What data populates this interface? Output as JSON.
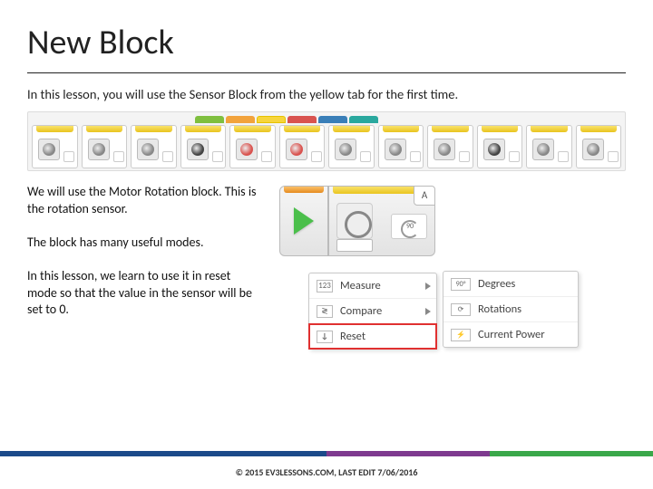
{
  "title": "New Block",
  "intro": "In this lesson, you will use the Sensor Block from the yellow tab for the first time.",
  "para1": "We will use the Motor Rotation block.  This is the rotation sensor.",
  "para2": "The block has many useful modes.",
  "para3": "In this lesson, we learn to use it in reset mode so that the value in the sensor will be set to 0.",
  "port_label": "A",
  "menu": {
    "measure": "Measure",
    "compare": "Compare",
    "reset": "Reset"
  },
  "submenu": {
    "degrees": "Degrees",
    "rotations": "Rotations",
    "current_power": "Current Power"
  },
  "icons": {
    "measure": "123",
    "compare": "≷",
    "reset": "↓",
    "degrees": "90°",
    "rotations": "⟳",
    "power": "⚡"
  },
  "footer": "© 2015 EV3LESSONS.COM, LAST EDIT 7/06/2016"
}
